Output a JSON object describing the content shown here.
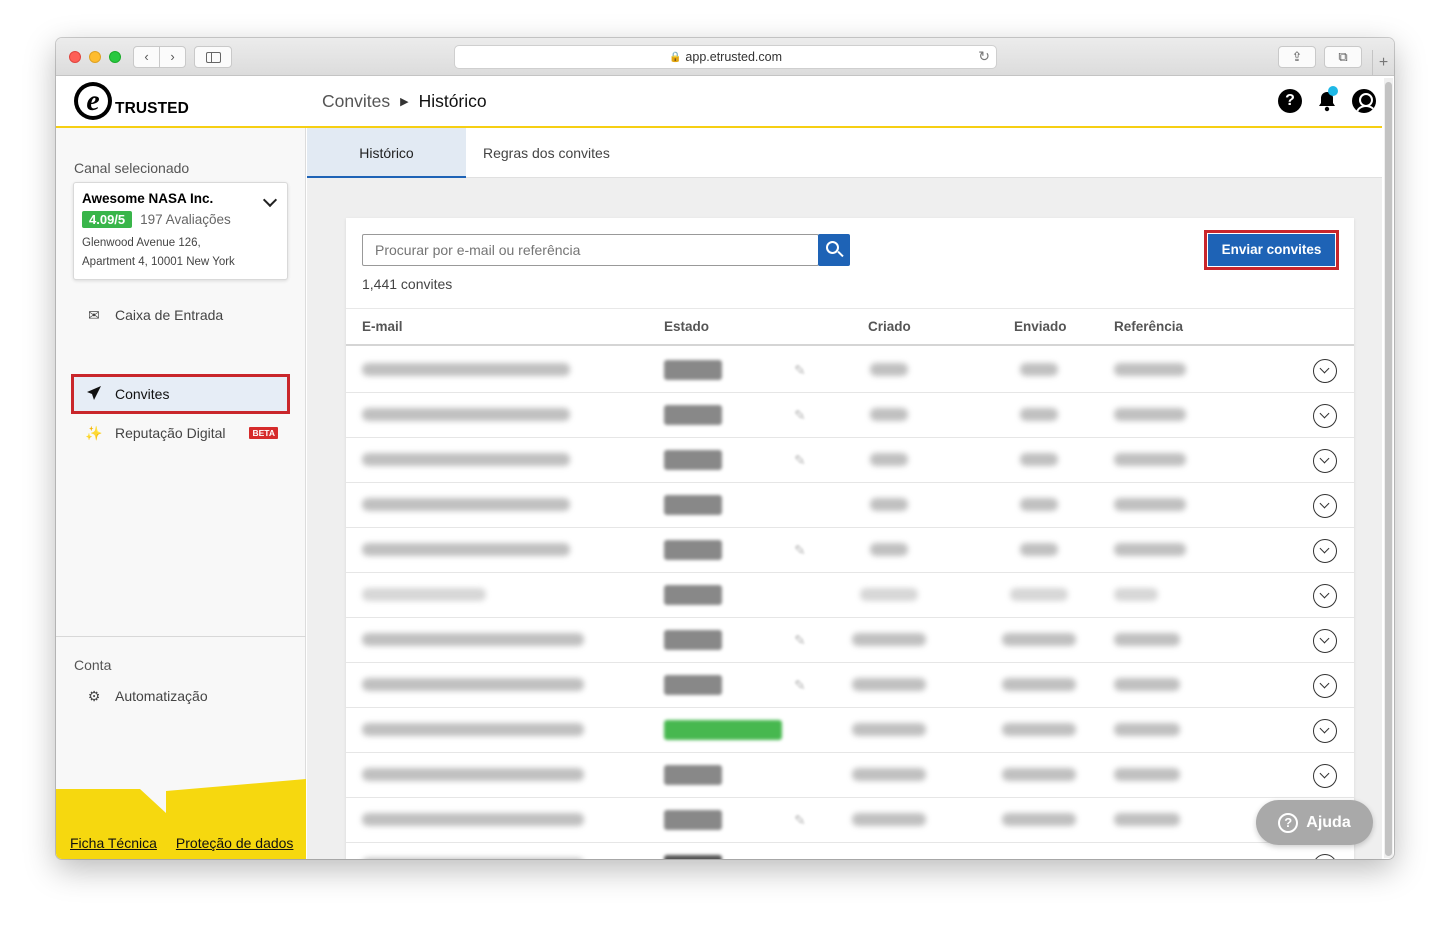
{
  "browser": {
    "url": "app.etrusted.com"
  },
  "header": {
    "brand": "TRUSTED",
    "breadcrumb_parent": "Convites",
    "breadcrumb_current": "Histórico"
  },
  "sidebar": {
    "channel_label": "Canal selecionado",
    "channel": {
      "name": "Awesome NASA Inc.",
      "rating": "4.09/5",
      "reviews": "197 Avaliações",
      "address_line1": "Glenwood Avenue 126,",
      "address_line2": "Apartment 4, 10001 New York"
    },
    "items": [
      {
        "label": "Caixa de Entrada",
        "icon": "inbox-icon"
      },
      {
        "label": "Convites",
        "icon": "paper-plane-icon",
        "active": true
      },
      {
        "label": "Reputação Digital",
        "icon": "sparkles-icon",
        "badge": "BETA"
      }
    ],
    "account_label": "Conta",
    "account_items": [
      {
        "label": "Automatização",
        "icon": "robot-icon"
      }
    ],
    "footer_links": [
      "Ficha Técnica",
      "Proteção de dados"
    ]
  },
  "tabs": [
    "Histórico",
    "Regras dos convites"
  ],
  "search": {
    "placeholder": "Procurar por e-mail ou referência"
  },
  "send_button": "Enviar convites",
  "invite_count": "1,441 convites",
  "table": {
    "columns": [
      "E-mail",
      "Estado",
      "Criado",
      "Enviado",
      "Referência"
    ]
  },
  "help_button": "Ajuda",
  "colors": {
    "brand_yellow": "#f6cf13",
    "primary_blue": "#1e63b6",
    "highlight_red": "#c9262b",
    "rating_green": "#39b54a"
  }
}
